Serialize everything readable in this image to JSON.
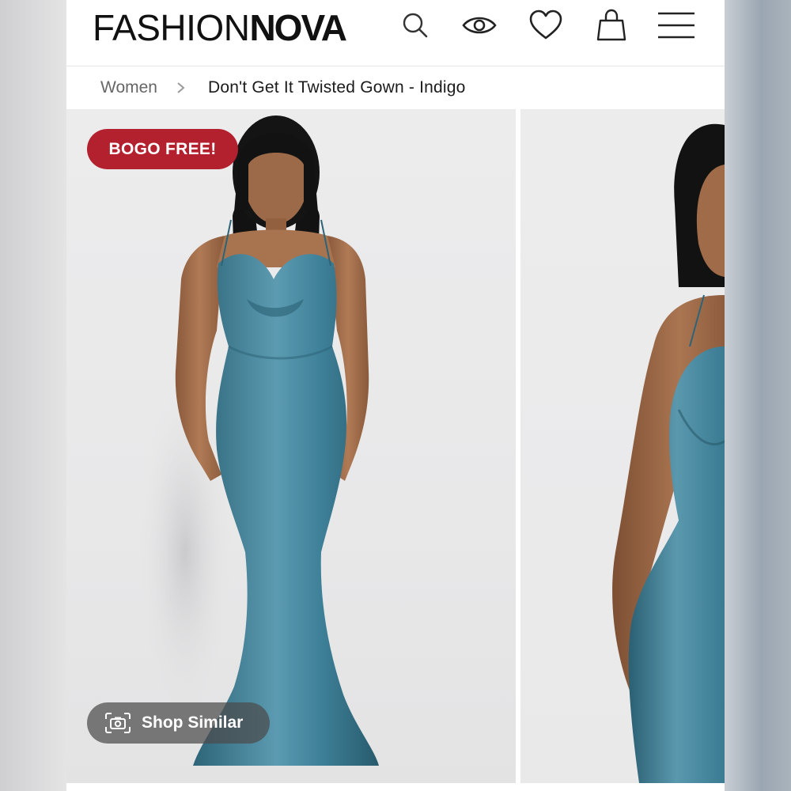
{
  "header": {
    "logo_light": "FASHION",
    "logo_bold": "NOVA",
    "icons": [
      "search-icon",
      "eye-icon",
      "heart-icon",
      "shopping-bag-icon",
      "menu-icon"
    ]
  },
  "breadcrumb": {
    "parent": "Women",
    "separator_icon": "chevron-right-icon",
    "current": "Don't Get It Twisted Gown - Indigo"
  },
  "gallery": {
    "badge": "BOGO FREE!",
    "shop_similar": "Shop Similar",
    "shop_similar_icon": "camera-icon"
  },
  "colors": {
    "badge": "#b3202e",
    "dress": "#3f7f96",
    "text": "#111111"
  }
}
